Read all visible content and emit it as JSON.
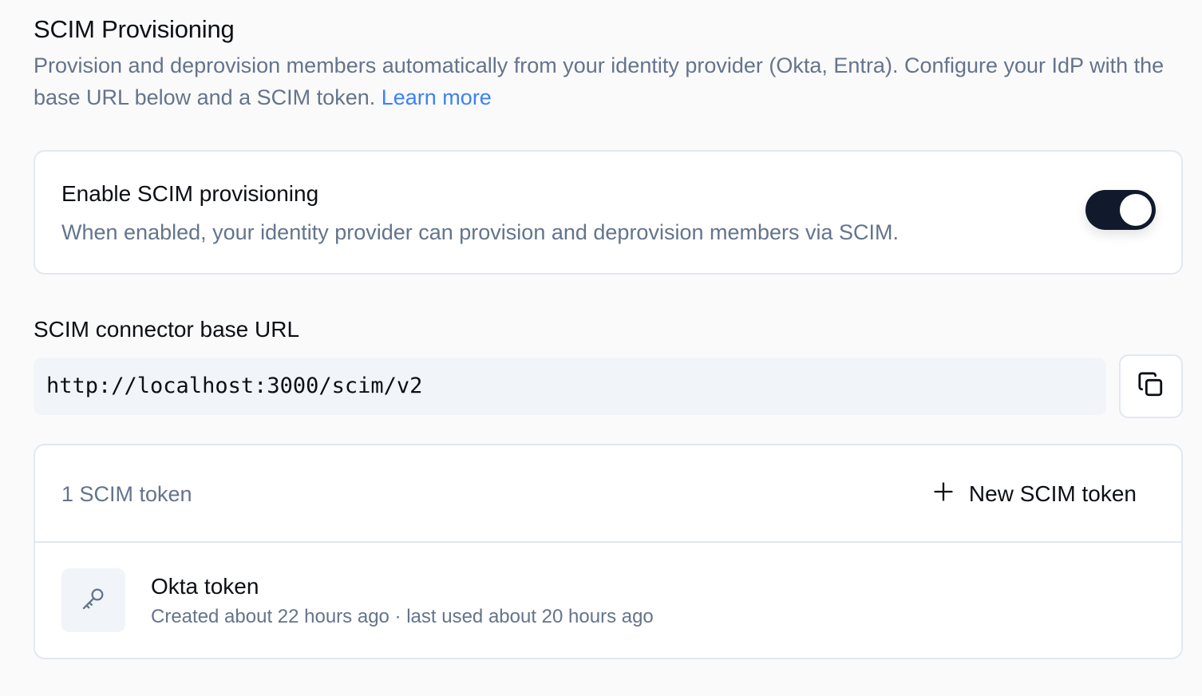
{
  "section": {
    "title": "SCIM Provisioning",
    "description": "Provision and deprovision members automatically from your identity provider (Okta, Entra). Configure your IdP with the base URL below and a SCIM token.",
    "learn_more": "Learn more"
  },
  "toggle": {
    "title": "Enable SCIM provisioning",
    "description": "When enabled, your identity provider can provision and deprovision members via SCIM.",
    "enabled": true,
    "accent_color": "#111a2c"
  },
  "connector": {
    "label": "SCIM connector base URL",
    "url": "http://localhost:3000/scim/v2",
    "copy_icon": "copy-icon"
  },
  "tokens": {
    "count_label": "1 SCIM token",
    "new_button_label": "New SCIM token",
    "new_button_icon": "plus-icon",
    "items": [
      {
        "name": "Okta token",
        "meta": "Created about 22 hours ago · last used about 20 hours ago",
        "icon": "key-icon"
      }
    ]
  },
  "colors": {
    "link": "#3b82f6",
    "muted_text": "#64748b",
    "border": "#e2e8f0",
    "background": "#fafafa"
  }
}
